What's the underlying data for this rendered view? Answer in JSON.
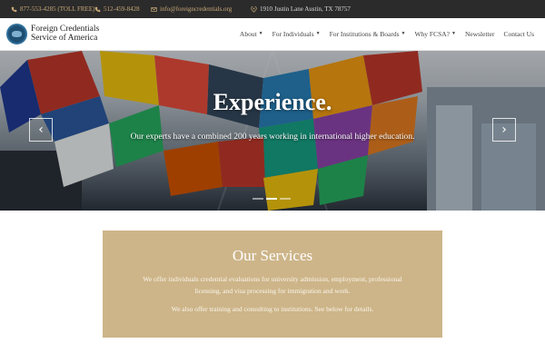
{
  "topbar": {
    "phone_tollfree": "877-553-4285 (TOLL FREE)",
    "phone_local": "512-459-8428",
    "email": "info@foreigncredentials.org",
    "address": "1910 Justin Lane Austin, TX 78757"
  },
  "header": {
    "brand_line1": "Foreign Credentials",
    "brand_line2": "Service of America",
    "nav": [
      {
        "label": "About",
        "dropdown": true
      },
      {
        "label": "For Individuals",
        "dropdown": true
      },
      {
        "label": "For Institutions & Boards",
        "dropdown": true
      },
      {
        "label": "Why FCSA?",
        "dropdown": true
      },
      {
        "label": "Newsletter",
        "dropdown": false
      },
      {
        "label": "Contact Us",
        "dropdown": false
      }
    ]
  },
  "hero": {
    "title": "Experience.",
    "subtitle": "Our experts have a combined 200 years working in international higher education.",
    "prev_glyph": "‹",
    "next_glyph": "›",
    "slide_count": 3,
    "active_slide": 2
  },
  "services": {
    "heading": "Our Services",
    "paragraph1": "We offer individuals credential evaluations for university admission, employment, professional licensing, and visa processing for immigration and work.",
    "paragraph2": "We also offer training and consulting to institutions. See below for details."
  },
  "colors": {
    "topbar_bg": "#2b2b2b",
    "topbar_accent": "#c8a878",
    "services_bg": "#cdb589"
  }
}
